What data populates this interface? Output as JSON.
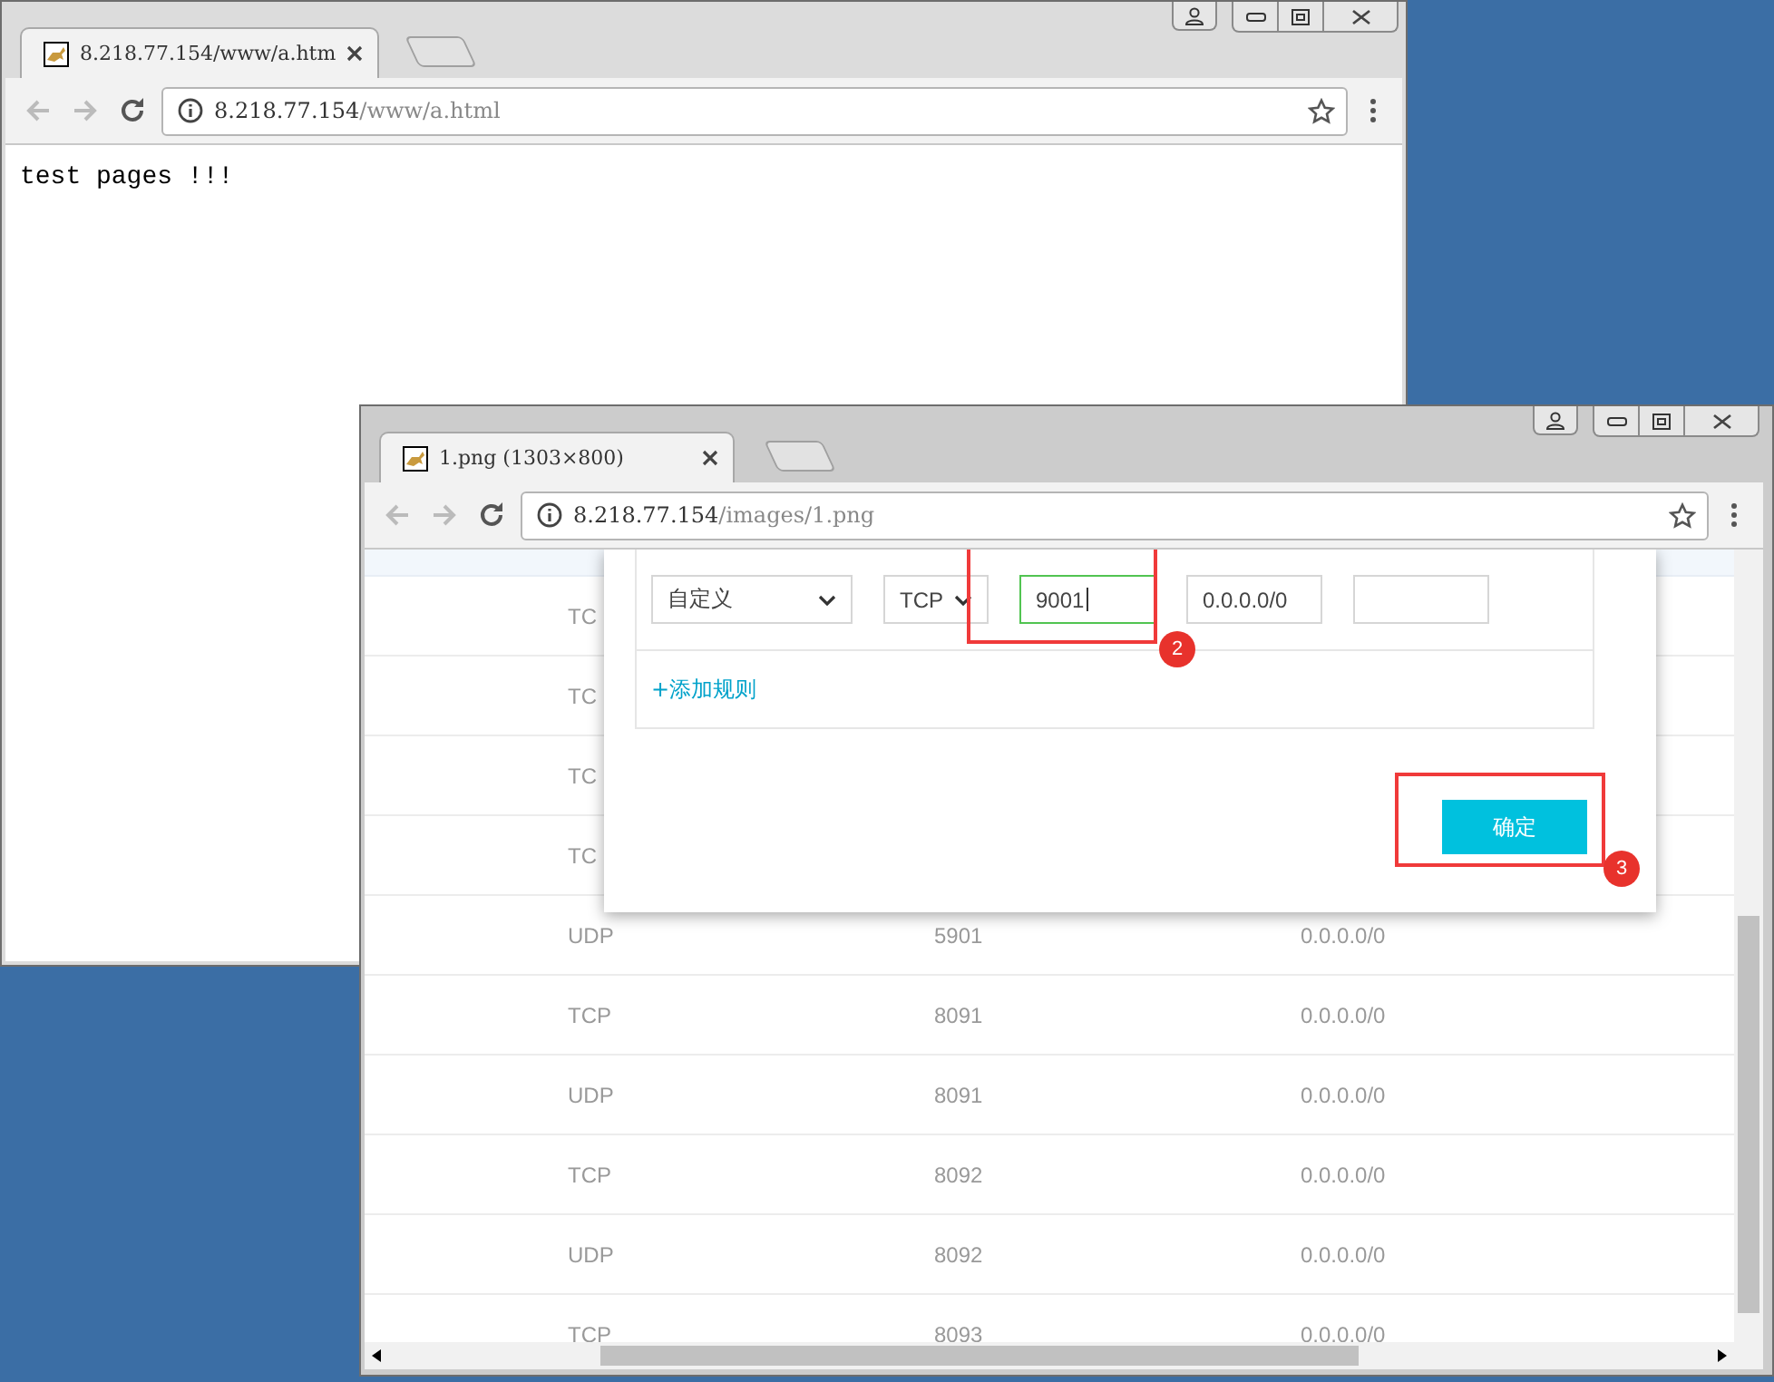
{
  "windows": [
    {
      "focused": false,
      "tab": {
        "title": "8.218.77.154/www/a.htm",
        "selected": true
      },
      "address": {
        "host": "8.218.77.154",
        "path": "/www/a.html"
      },
      "page_text": "test pages !!!"
    },
    {
      "focused": true,
      "tab": {
        "title": "1.png (1303×800)",
        "selected": true
      },
      "address": {
        "host": "8.218.77.154",
        "path": "/images/1.png"
      },
      "image": {
        "rules_table": {
          "rows": [
            {
              "protocol": "TC"
            },
            {
              "protocol": "TC"
            },
            {
              "protocol": "TC"
            },
            {
              "protocol": "TC"
            },
            {
              "protocol": "UDP",
              "port": "5901",
              "source": "0.0.0.0/0"
            },
            {
              "protocol": "TCP",
              "port": "8091",
              "source": "0.0.0.0/0"
            },
            {
              "protocol": "UDP",
              "port": "8091",
              "source": "0.0.0.0/0"
            },
            {
              "protocol": "TCP",
              "port": "8092",
              "source": "0.0.0.0/0"
            },
            {
              "protocol": "UDP",
              "port": "8092",
              "source": "0.0.0.0/0"
            },
            {
              "protocol": "TCP",
              "port": "8093",
              "source": "0.0.0.0/0"
            }
          ]
        },
        "dialog": {
          "rule": {
            "type": "自定义",
            "protocol": "TCP",
            "port": "9001",
            "source": "0.0.0.0/0"
          },
          "add_rule_link": "+添加规则",
          "confirm_button": "确定"
        },
        "callouts": [
          {
            "number": "2"
          },
          {
            "number": "3"
          }
        ]
      }
    }
  ]
}
